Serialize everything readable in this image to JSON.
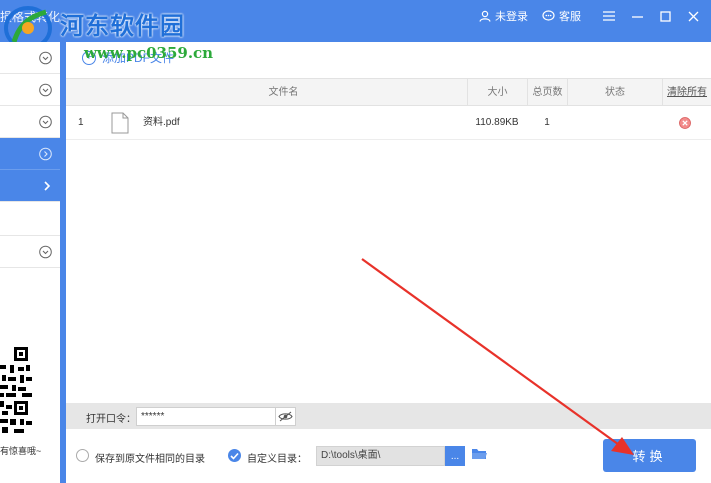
{
  "titlebar": {
    "title_fragment": "损格式转化",
    "watermark": "河东软件园",
    "watermark_url": "www.pc0359.cn",
    "login_label": "未登录",
    "service_label": "客服"
  },
  "sidebar": {
    "qr_caption": "有惊喜哦~"
  },
  "toolbar": {
    "add_file_label": "添加PDF文件"
  },
  "table": {
    "headers": {
      "name": "文件名",
      "size": "大小",
      "pages": "总页数",
      "status": "状态",
      "clear_all": "清除所有"
    },
    "rows": [
      {
        "index": "1",
        "name": "资料.pdf",
        "size": "110.89KB",
        "pages": "1",
        "status": ""
      }
    ]
  },
  "password": {
    "label": "打开口令：",
    "value": "******"
  },
  "output": {
    "same_dir_label": "保存到原文件相同的目录",
    "custom_dir_label": "自定义目录：",
    "custom_dir_value": "D:\\tools\\桌面\\",
    "browse_label": "...",
    "convert_label": "转换"
  },
  "colors": {
    "accent": "#4a86e8",
    "annotation_arrow": "#e8322a"
  }
}
